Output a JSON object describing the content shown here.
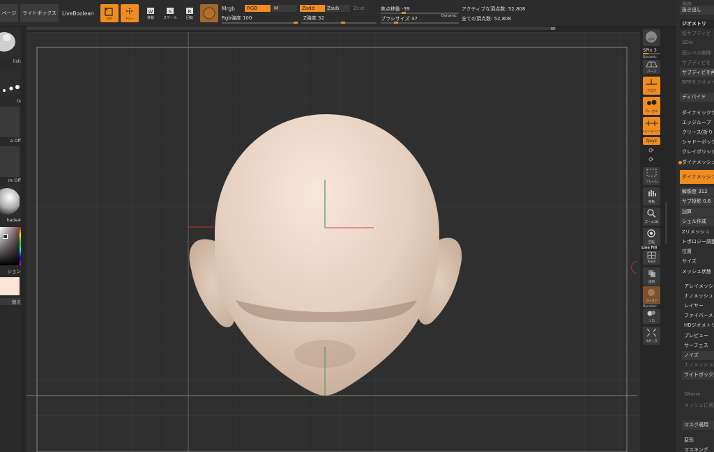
{
  "topbar": {
    "page_label": "ページ",
    "lightbox_label": "ライトボックス",
    "liveboolean_label": "LiveBoolean",
    "edit_label": "Edit",
    "draw_label": "ドロー",
    "move_label": "移動",
    "scale_label": "スケール",
    "rotate_label": "回転",
    "mrgb_label": "Mrgb",
    "rgb_label": "RGB",
    "m_label": "M",
    "zadd_label": "Zadd",
    "zsub_label": "Zsub",
    "zcut_label": "Zcut",
    "rgb_intensity_label": "Rgb強度 100",
    "z_intensity_label": "Z強度 32",
    "focal_shift_label": "焦点移動 -39",
    "brush_size_label": "ブラシサイズ 37",
    "dynamic_label": "Dynamic",
    "active_points_label": "アクティブな頂点数: 52,808",
    "total_points_label": "全ての頂点数: 52,808",
    "rgb_intensity_value": 100,
    "z_intensity_value": 32,
    "focal_shift_value": -39,
    "brush_size_value": 37
  },
  "left_panel": {
    "captions": [
      "lish",
      "ts",
      "a Off",
      "re Off",
      "hade4",
      "ション",
      "替え"
    ]
  },
  "right_toolbar": {
    "bpr_label": "BPR",
    "spix_label": "SPix 3",
    "dynamic_label": "Dynamic",
    "perspective_label": "パース",
    "floor_label": "フロア",
    "local_label": "ローカル",
    "lsym_label": "Lシンメトリ",
    "xyz_label": "Qxyz",
    "frame_label": "フレーム",
    "move_label": "移動",
    "zoom_label": "ズーム3D",
    "rotate_label": "回転",
    "linefill_label": "Line Fill",
    "polyf_label": "PolyF",
    "transp_label": "透明",
    "ghost_label": "ゴースト",
    "dynamic2_label": "Dynamic",
    "solo_label": "ソロ",
    "xpose_label": "Xポーズ"
  },
  "right_panel": {
    "items": [
      {
        "label": "保存",
        "style": "dim"
      },
      {
        "label": "抜き出し",
        "style": "box"
      },
      {
        "label": "ジオメトリ",
        "style": "header"
      },
      {
        "label": "低サブディビ",
        "style": "dim"
      },
      {
        "label": "SDiv",
        "style": "dim"
      },
      {
        "label": "低レベル削除",
        "style": "dim"
      },
      {
        "label": "サブディビを",
        "style": "dim"
      },
      {
        "label": "サブディビを再",
        "style": "box"
      },
      {
        "label": "BPRをジオメト",
        "style": "dim"
      },
      {
        "label": "ディバイド",
        "style": "box"
      },
      {
        "label": "ダイナミックサ",
        "style": "plain"
      },
      {
        "label": "エッジループ",
        "style": "plain"
      },
      {
        "label": "クリース(折り",
        "style": "plain"
      },
      {
        "label": "シャドーボック",
        "style": "plain"
      },
      {
        "label": "クレイポリッシ",
        "style": "plain"
      },
      {
        "label": "ダイナメッシュ",
        "style": "plain"
      },
      {
        "label": "ダイナメッシュ",
        "style": "hl"
      },
      {
        "label": "解像度 312",
        "style": "box"
      },
      {
        "label": "サブ投影 0.6",
        "style": "box"
      },
      {
        "label": "加算",
        "style": "box"
      },
      {
        "label": "シェル作成",
        "style": "box"
      },
      {
        "label": "Zリメッシュ",
        "style": "plain"
      },
      {
        "label": "トポロジー調整",
        "style": "plain"
      },
      {
        "label": "位置",
        "style": "plain"
      },
      {
        "label": "サイズ",
        "style": "plain"
      },
      {
        "label": "メッシュ状態",
        "style": "plain"
      },
      {
        "label": "アレイメッシュ",
        "style": "plain"
      },
      {
        "label": "ナノメッシュ",
        "style": "plain"
      },
      {
        "label": "レイヤー",
        "style": "plain"
      },
      {
        "label": "ファイバーメ",
        "style": "plain"
      },
      {
        "label": "HDジオメトリ",
        "style": "plain"
      },
      {
        "label": "プレビュー",
        "style": "plain"
      },
      {
        "label": "サーフェス",
        "style": "plain"
      },
      {
        "label": "ノイズ",
        "style": "box"
      },
      {
        "label": "ナノメッシュに",
        "style": "dim"
      },
      {
        "label": "ライトボックス",
        "style": "box"
      },
      {
        "label": "SNorm",
        "style": "dim"
      },
      {
        "label": "メッシュに適用",
        "style": "dim"
      },
      {
        "label": "マスク適用",
        "style": "box"
      },
      {
        "label": "変形",
        "style": "plain"
      },
      {
        "label": "マスキング",
        "style": "plain"
      }
    ]
  },
  "colors": {
    "accent": "#f08c20",
    "skin": "#e8d3c2",
    "swatch": "#fde3d8"
  }
}
